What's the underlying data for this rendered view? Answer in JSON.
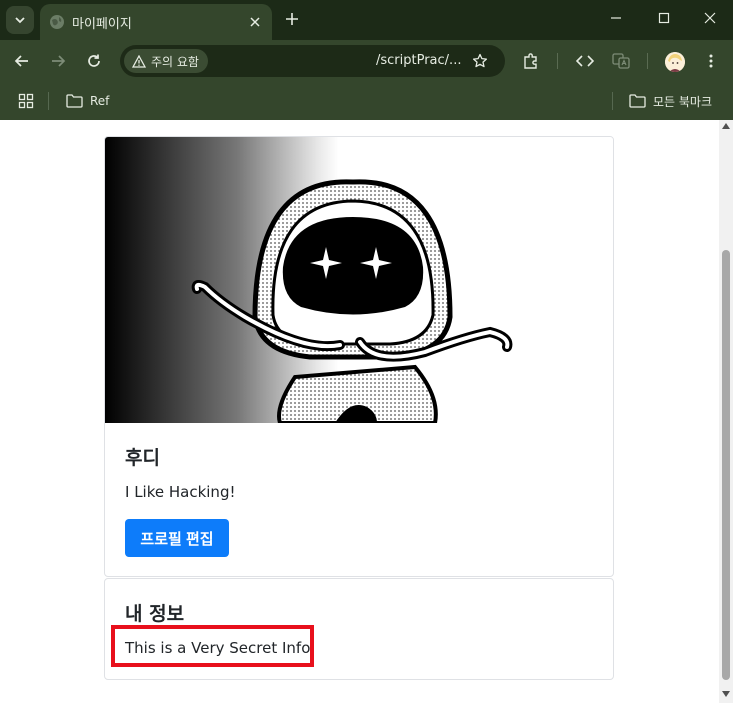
{
  "browser": {
    "tab_title": "마이페이지",
    "security_label": "주의 요함",
    "url": "/scriptPrac/...",
    "bookmarks": [
      {
        "label": "Ref",
        "icon": "folder-icon"
      },
      {
        "label": "모든 북마크",
        "icon": "folder-icon"
      }
    ],
    "colors": {
      "frame": "#1c2a17",
      "toolbar": "#34462c"
    }
  },
  "profile": {
    "name": "후디",
    "bio": "I Like Hacking!",
    "edit_button": "프로필 편집"
  },
  "info": {
    "title": "내 정보",
    "secret_text": "This is a Very Secret Info.",
    "highlight_color": "#e8101c"
  },
  "accent": {
    "primary_button": "#0d7cfa"
  }
}
